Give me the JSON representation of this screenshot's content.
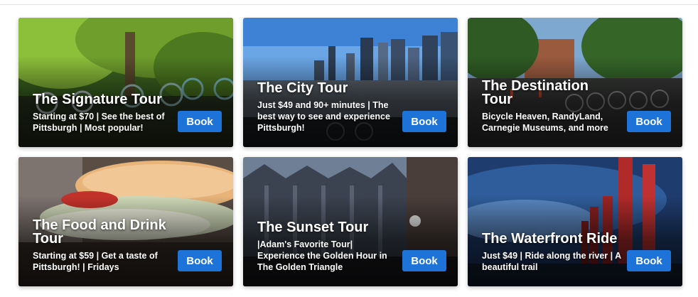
{
  "tours": [
    {
      "title": "The Signature Tour",
      "description": "Starting at $70 | See the best of Pittsburgh | Most popular!",
      "button": "Book",
      "icon": "forest-bikes-photo"
    },
    {
      "title": "The City Tour",
      "description": "Just $49 and 90+ minutes | The best way to see and experience Pittsburgh!",
      "button": "Book",
      "icon": "city-skyline-photo"
    },
    {
      "title": "The Destination Tour",
      "description": "Bicycle Heaven, RandyLand, Carnegie Museums, and more",
      "button": "Book",
      "icon": "bike-row-photo"
    },
    {
      "title": "The Food and Drink Tour",
      "description": "Starting at $59 | Get a taste of Pittsburgh! | Fridays",
      "button": "Book",
      "icon": "sandwich-photo"
    },
    {
      "title": "The Sunset Tour",
      "description": "|Adam's Favorite Tour| Experience the Golden Hour in The Golden Triangle",
      "button": "Book",
      "icon": "glass-towers-photo"
    },
    {
      "title": "The Waterfront Ride",
      "description": "Just $49 | Ride along the river | A beautiful trail",
      "button": "Book",
      "icon": "smokestacks-photo"
    }
  ],
  "colors": {
    "button": "#1e73d8",
    "text": "#ffffff"
  }
}
